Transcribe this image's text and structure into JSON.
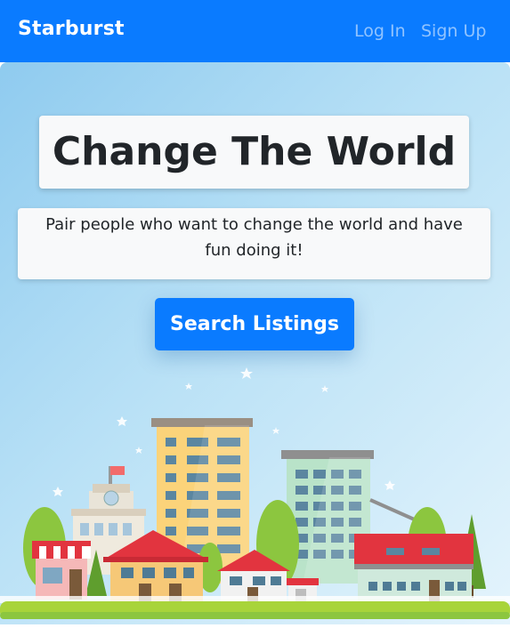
{
  "navbar": {
    "brand": "Starburst",
    "links": [
      {
        "label": "Log In"
      },
      {
        "label": "Sign Up"
      }
    ]
  },
  "hero": {
    "title": "Change The World",
    "subtitle": "Pair people who want to change the world and have fun doing it!",
    "cta_label": "Search Listings"
  },
  "colors": {
    "primary": "#0a7bff",
    "card_bg": "#f8f9fa",
    "text_dark": "#212529"
  },
  "illustration": {
    "icon": "city-skyline-illustration"
  }
}
